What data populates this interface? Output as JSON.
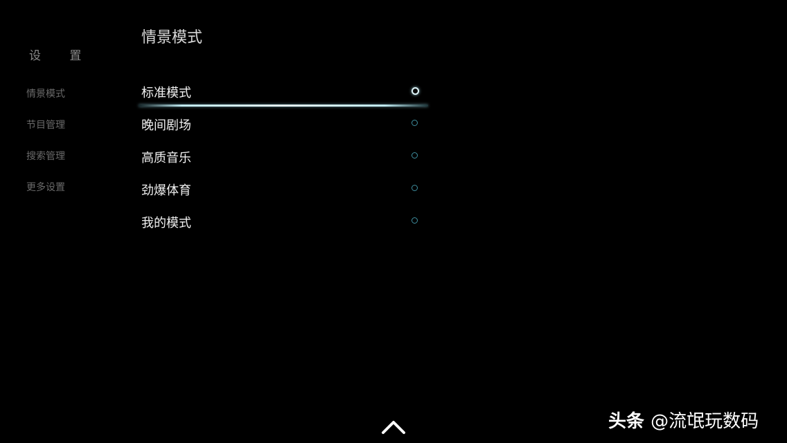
{
  "sidebar": {
    "title": "设 置",
    "items": [
      {
        "label": "情景模式"
      },
      {
        "label": "节目管理"
      },
      {
        "label": "搜索管理"
      },
      {
        "label": "更多设置"
      }
    ]
  },
  "page": {
    "title": "情景模式"
  },
  "modes": [
    {
      "label": "标准模式",
      "selected": true
    },
    {
      "label": "晚间剧场",
      "selected": false
    },
    {
      "label": "高质音乐",
      "selected": false
    },
    {
      "label": "劲爆体育",
      "selected": false
    },
    {
      "label": "我的模式",
      "selected": false
    }
  ],
  "icons": {
    "radio": "radio-icon",
    "up": "chevron-up-icon"
  },
  "colors": {
    "background": "#000000",
    "accent": "#bfe8ef",
    "radio_ring": "#3f8fa0"
  },
  "watermark": {
    "brand": "头条",
    "handle": "@流氓玩数码"
  }
}
